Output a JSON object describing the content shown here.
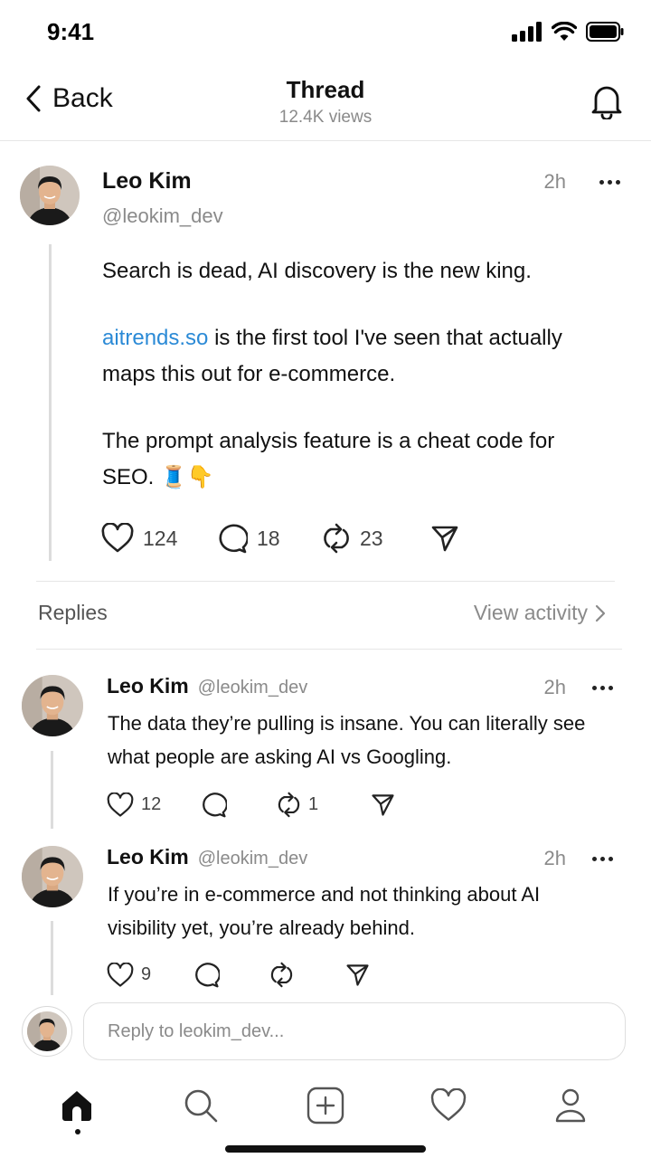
{
  "status_bar": {
    "time": "9:41"
  },
  "header": {
    "back_label": "Back",
    "title": "Thread",
    "subtitle": "12.4K views"
  },
  "post": {
    "author": "Leo Kim",
    "handle": "@leokim_dev",
    "time": "2h",
    "paragraph1": "Search is dead, AI discovery is the new king.",
    "link_text": "aitrends.so",
    "paragraph2_rest": " is the first tool I've seen that actually maps this out for e-commerce.",
    "paragraph3": "The prompt analysis feature is a cheat code for SEO. 🧵👇",
    "likes": "124",
    "comments": "18",
    "reposts": "23"
  },
  "replies_header": {
    "label": "Replies",
    "view_activity": "View activity"
  },
  "replies": [
    {
      "author": "Leo Kim",
      "handle": "@leokim_dev",
      "time": "2h",
      "text": "The data they’re pulling is insane. You can literally see what people are asking AI vs Googling.",
      "likes": "12",
      "comments": "",
      "reposts": "1"
    },
    {
      "author": "Leo Kim",
      "handle": "@leokim_dev",
      "time": "2h",
      "text": "If you’re in e-commerce and not thinking about AI visibility yet, you’re already behind.",
      "likes": "9",
      "comments": "",
      "reposts": ""
    }
  ],
  "composer": {
    "placeholder": "Reply to leokim_dev..."
  },
  "tabs": [
    "home-icon",
    "search-icon",
    "new-post-icon",
    "activity-heart-icon",
    "profile-icon"
  ],
  "colors": {
    "link": "#2b8ad6",
    "muted": "#8a8a8a",
    "text": "#111111"
  }
}
